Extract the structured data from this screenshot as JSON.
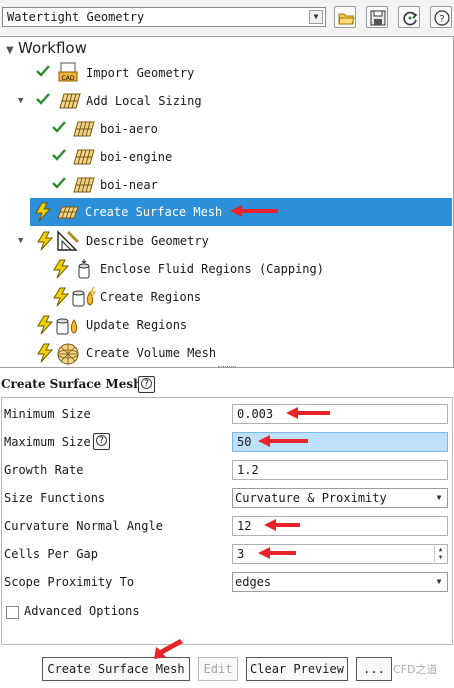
{
  "workflow_select": {
    "value": "Watertight Geometry",
    "arrow_icon": "chevron-down-icon"
  },
  "toolbar_icons": [
    "folder-open-icon",
    "save-icon",
    "refresh-icon",
    "help-icon"
  ],
  "tree": {
    "title": "Workflow",
    "items": [
      {
        "label": "Import Geometry",
        "status": "done",
        "icon": "cad-file-icon"
      },
      {
        "label": "Add Local Sizing",
        "status": "done",
        "icon": "mesh-grid-icon"
      },
      {
        "label": "boi-aero",
        "status": "done",
        "icon": "mesh-grid-icon"
      },
      {
        "label": "boi-engine",
        "status": "done",
        "icon": "mesh-grid-icon"
      },
      {
        "label": "boi-near",
        "status": "done",
        "icon": "mesh-grid-icon"
      },
      {
        "label": "Create Surface Mesh",
        "status": "pending",
        "icon": "surface-mesh-icon",
        "selected": true
      },
      {
        "label": "Describe Geometry",
        "status": "pending",
        "icon": "geometry-triangle-icon"
      },
      {
        "label": "Enclose Fluid Regions (Capping)",
        "status": "pending",
        "icon": "capping-icon"
      },
      {
        "label": "Create Regions",
        "status": "pending",
        "icon": "regions-icon"
      },
      {
        "label": "Update Regions",
        "status": "pending",
        "icon": "regions-icon"
      },
      {
        "label": "Create Volume Mesh",
        "status": "pending",
        "icon": "volume-mesh-icon"
      }
    ]
  },
  "task": {
    "title": "Create Surface Mesh",
    "fields": {
      "min_size": {
        "label": "Minimum Size",
        "value": "0.003"
      },
      "max_size": {
        "label": "Maximum Size",
        "value": "50"
      },
      "growth_rate": {
        "label": "Growth Rate",
        "value": "1.2"
      },
      "size_functions": {
        "label": "Size Functions",
        "value": "Curvature & Proximity"
      },
      "curvature_angle": {
        "label": "Curvature Normal Angle",
        "value": "12"
      },
      "cells_per_gap": {
        "label": "Cells Per Gap",
        "value": "3"
      },
      "scope_proximity": {
        "label": "Scope Proximity To",
        "value": "edges"
      }
    },
    "advanced_label": "Advanced Options",
    "advanced_checked": false
  },
  "buttons": {
    "create": "Create Surface Mesh",
    "edit": "Edit",
    "clear": "Clear Preview",
    "more": "..."
  },
  "watermark": "CFD之道",
  "colors": {
    "selection": "#2b8fd9",
    "check": "#2e8b2e",
    "bolt": "#f5d100",
    "annotation_arrow": "#e8242a",
    "highlight_field": "#bde0fb"
  }
}
